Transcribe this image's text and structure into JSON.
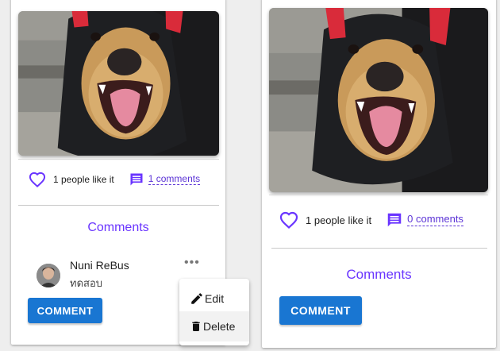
{
  "left_post": {
    "likes_text": "1 people like it",
    "comments_link": "1 comments",
    "comments_title": "Comments",
    "comment": {
      "author": "Nuni ReBus",
      "text": "ทดสอบ"
    },
    "more_label": "•••",
    "comment_button": "COMMENT"
  },
  "menu": {
    "edit_label": "Edit",
    "delete_label": "Delete"
  },
  "right_post": {
    "likes_text": "1 people like it",
    "comments_link": "0 comments",
    "comments_title": "Comments",
    "comment_button": "COMMENT"
  },
  "colors": {
    "accent_purple": "#6a35ff",
    "primary_blue": "#1976d2",
    "link_purple": "#5c34d6"
  }
}
